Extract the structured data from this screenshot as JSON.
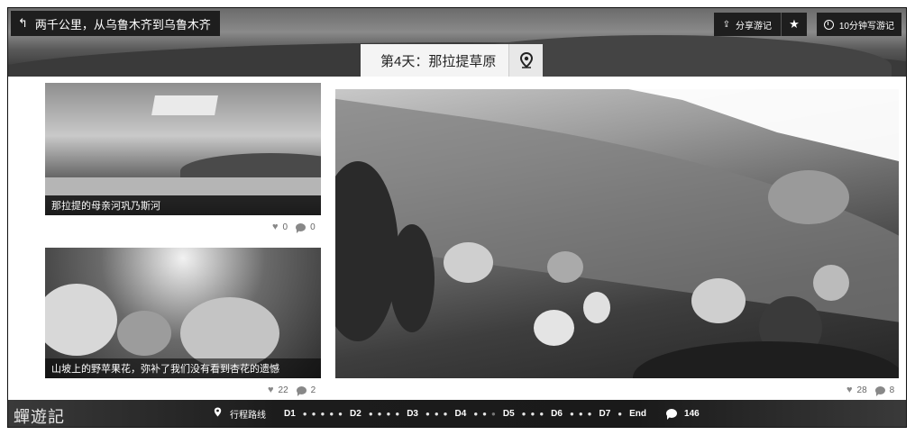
{
  "header": {
    "back_label": "两千公里，从乌鲁木齐到乌鲁木齐",
    "share_label": "分享游记",
    "write_label": "10分钟写游记",
    "day_title": "第4天：那拉提草原"
  },
  "photos": [
    {
      "caption": "那拉提的母亲河巩乃斯河",
      "likes": "0",
      "comments": "0"
    },
    {
      "caption": "山坡上的野苹果花，弥补了我们没有看到杏花的遗憾",
      "likes": "22",
      "comments": "2"
    },
    {
      "caption": "",
      "likes": "28",
      "comments": "8"
    }
  ],
  "footer": {
    "logo": "蟬遊記",
    "route_label": "行程路线",
    "days": [
      "D1",
      "D2",
      "D3",
      "D4",
      "D5",
      "D6",
      "D7",
      "End"
    ],
    "comment_count": "146"
  },
  "icons": {
    "back": "back-arrow-icon",
    "share": "share-icon",
    "star": "star-icon",
    "clock": "clock-icon",
    "location": "location-pin-icon",
    "heart": "heart-icon",
    "comment": "comment-icon"
  }
}
